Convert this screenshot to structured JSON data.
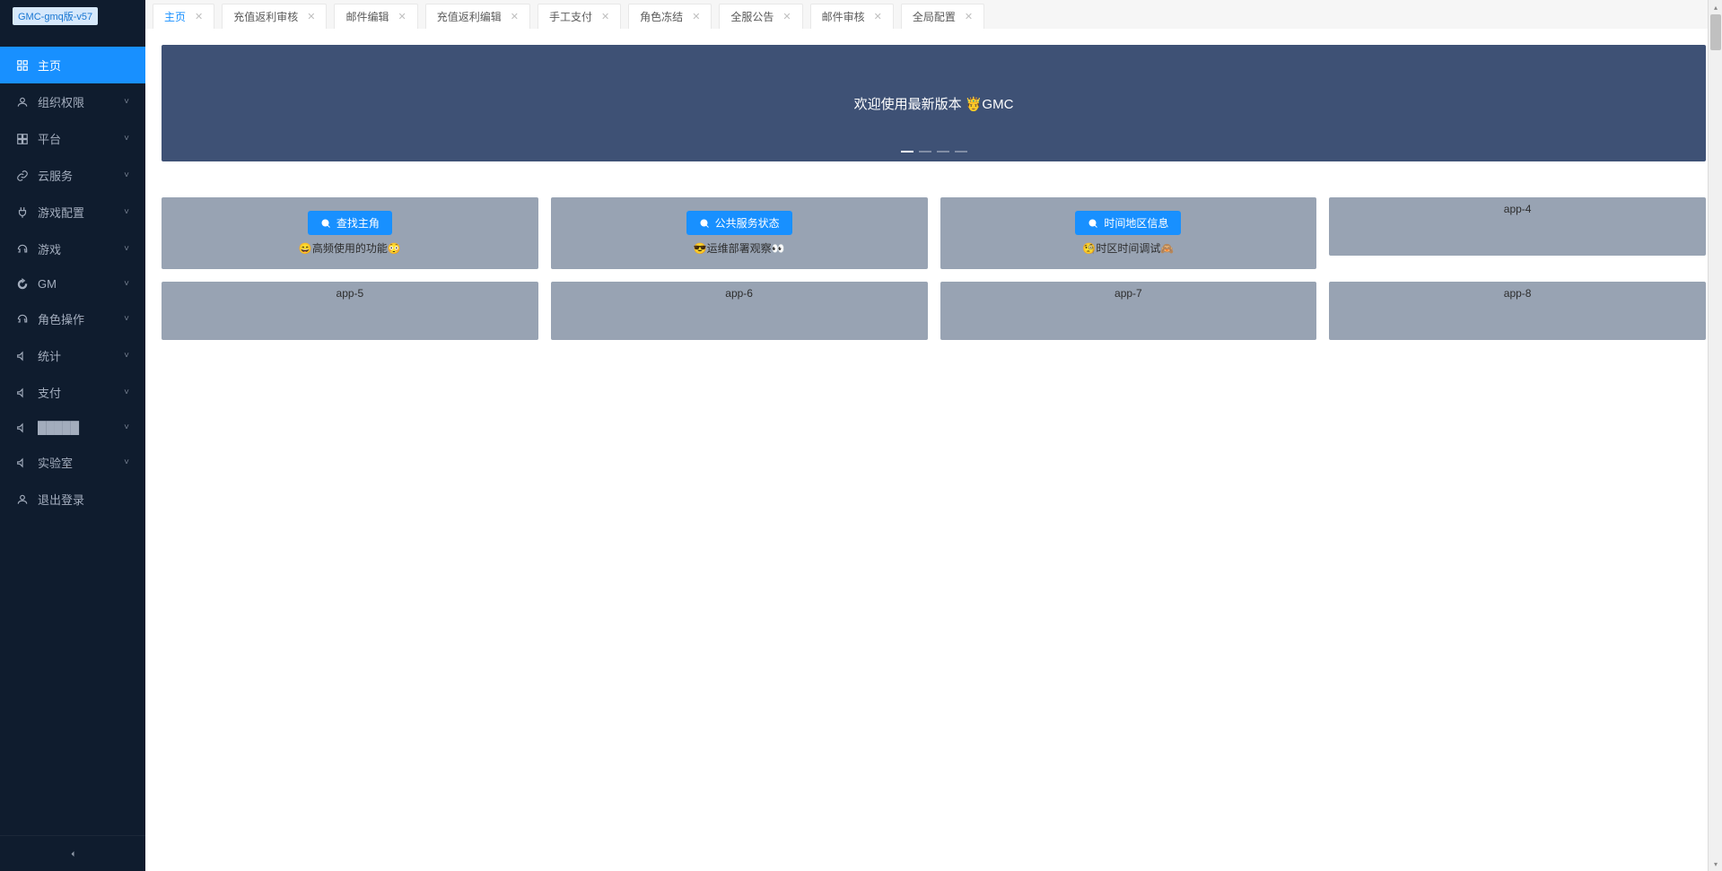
{
  "logo": {
    "badge": "GMC-gmq版-v57"
  },
  "sidebar": {
    "items": [
      {
        "label": "主页",
        "icon": "grid",
        "chevron": ""
      },
      {
        "label": "组织权限",
        "icon": "user",
        "chevron": "˅"
      },
      {
        "label": "平台",
        "icon": "boxes",
        "chevron": "˅"
      },
      {
        "label": "云服务",
        "icon": "link",
        "chevron": "˅"
      },
      {
        "label": "游戏配置",
        "icon": "plug",
        "chevron": "˅"
      },
      {
        "label": "游戏",
        "icon": "headset",
        "chevron": "˅"
      },
      {
        "label": "GM",
        "icon": "refresh",
        "chevron": "˅"
      },
      {
        "label": "角色操作",
        "icon": "headset",
        "chevron": "˅"
      },
      {
        "label": "统计",
        "icon": "speaker",
        "chevron": "˅"
      },
      {
        "label": "支付",
        "icon": "speaker",
        "chevron": "˅"
      },
      {
        "label": "█████",
        "icon": "speaker",
        "chevron": "˅"
      },
      {
        "label": "实验室",
        "icon": "speaker",
        "chevron": "˅"
      },
      {
        "label": "退出登录",
        "icon": "user",
        "chevron": ""
      }
    ]
  },
  "tabs": [
    {
      "label": "主页",
      "active": true
    },
    {
      "label": "充值返利审核",
      "active": false
    },
    {
      "label": "邮件编辑",
      "active": false
    },
    {
      "label": "充值返利编辑",
      "active": false
    },
    {
      "label": "手工支付",
      "active": false
    },
    {
      "label": "角色冻结",
      "active": false
    },
    {
      "label": "全服公告",
      "active": false
    },
    {
      "label": "邮件审核",
      "active": false
    },
    {
      "label": "全局配置",
      "active": false
    }
  ],
  "banner": {
    "text": "欢迎使用最新版本 🤴GMC"
  },
  "cards": {
    "row1": [
      {
        "btn": "查找主角",
        "desc": "😄高频使用的功能😳"
      },
      {
        "btn": "公共服务状态",
        "desc": "😎运维部署观察👀"
      },
      {
        "btn": "时间地区信息",
        "desc": "🧐时区时间调试🙈"
      },
      {
        "label": "app-4"
      }
    ],
    "row2": [
      {
        "label": "app-5"
      },
      {
        "label": "app-6"
      },
      {
        "label": "app-7"
      },
      {
        "label": "app-8"
      }
    ]
  }
}
